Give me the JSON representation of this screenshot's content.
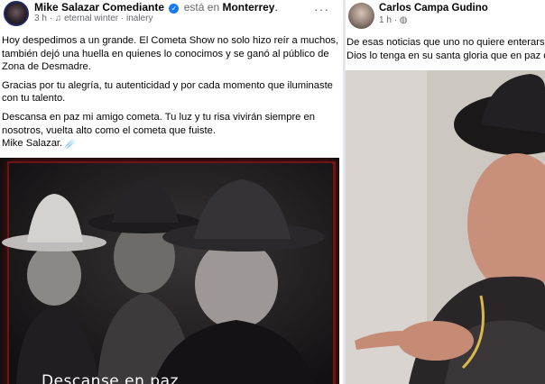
{
  "left_post": {
    "author": "Mike Salazar Comediante",
    "status_prefix": "está en",
    "location": "Monterrey",
    "time": "3 h",
    "music": "eternal winter · inalery",
    "paragraphs": [
      "Hoy despedimos a un grande. El Cometa Show no solo hizo reír a muchos, también dejó una huella en quienes lo conocimos y se ganó al público de Zona de Desmadre.",
      "Gracias por tu alegría, tu autenticidad y por cada momento que iluminaste con tu talento.",
      "Descansa en paz mi amigo cometa. Tu luz y tu risa vivirán siempre en nosotros, vuelta alto como el cometa que fuiste."
    ],
    "signature": "Mike Salazar.",
    "signature_emoji": "☄️",
    "photo_caption": "Descanse en paz"
  },
  "right_post": {
    "author": "Carlos Campa Gudino",
    "time": "1 h",
    "line1": "De esas  noticias que uno no quiere enterarse,",
    "line2": "Dios lo tenga en su santa gloria que en paz de"
  },
  "colors": {
    "verified_blue": "#1877f2",
    "frame_red": "#6d1414",
    "muted_text": "#65676b"
  }
}
